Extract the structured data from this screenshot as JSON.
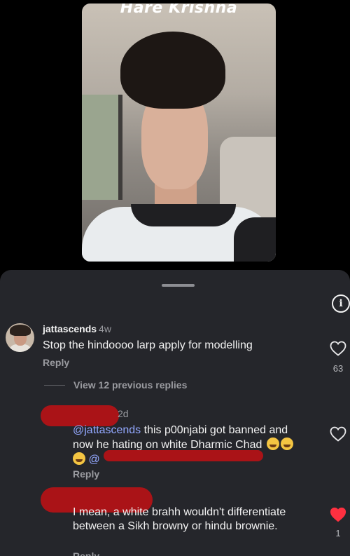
{
  "video": {
    "title": "Hare Krishna"
  },
  "sheet": {
    "info_label": "i"
  },
  "comments": [
    {
      "username": "jattascends",
      "time": "4w",
      "text": "Stop the hindoooo larp apply for modelling",
      "reply_label": "Reply",
      "likes": "63"
    }
  ],
  "view_replies_label": "View 12 previous replies",
  "replies": [
    {
      "time": "2d",
      "mention": "@jattascends",
      "text": " this p00njabi got banned and now he hating on white Dharmic Chad",
      "mention2": "@",
      "reply_label": "Reply"
    },
    {
      "text": "I mean, a white brahh wouldn't differentiate between a Sikh browny or hindu brownie.",
      "likes": "1",
      "reply_label": "Reply"
    }
  ],
  "colors": {
    "sheet_bg": "#25262b",
    "mention": "#93a8ff",
    "liked_heart": "#ff3040",
    "redaction": "#b11216"
  }
}
